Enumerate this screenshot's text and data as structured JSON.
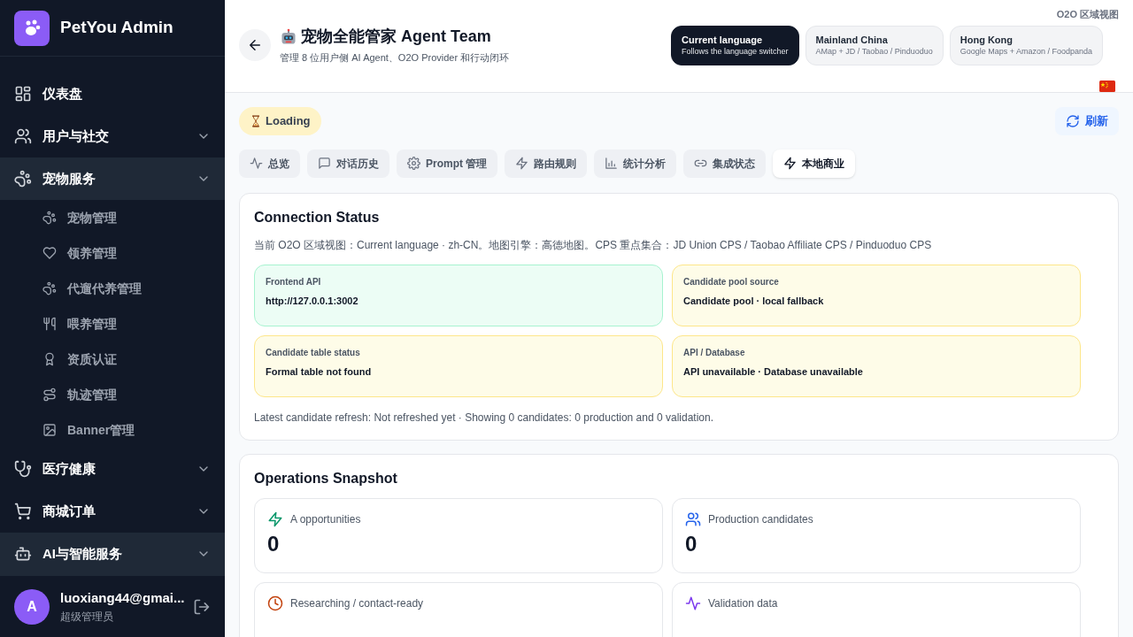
{
  "brand": {
    "name": "PetYou Admin"
  },
  "sidebar": {
    "items": [
      {
        "label": "仪表盘",
        "selected": false,
        "kind": "link"
      },
      {
        "label": "用户与社交",
        "selected": false,
        "kind": "group"
      },
      {
        "label": "宠物服务",
        "selected": true,
        "kind": "group",
        "children": [
          {
            "label": "宠物管理"
          },
          {
            "label": "领养管理"
          },
          {
            "label": "代遛代养管理"
          },
          {
            "label": "喂养管理"
          },
          {
            "label": "资质认证"
          },
          {
            "label": "轨迹管理"
          },
          {
            "label": "Banner管理"
          }
        ]
      },
      {
        "label": "医疗健康",
        "selected": false,
        "kind": "group"
      },
      {
        "label": "商城订单",
        "selected": false,
        "kind": "group"
      },
      {
        "label": "AI与智能服务",
        "selected": true,
        "kind": "group"
      }
    ]
  },
  "user": {
    "avatar": "A",
    "name": "luoxiang44@gmai...",
    "role": "超级管理员"
  },
  "header": {
    "title": "宠物全能管家 Agent Team",
    "subtitle": "管理 8 位用户侧 AI Agent、O2O Provider 和行动闭环",
    "region_label": "O2O 区域视图",
    "regions": [
      {
        "name": "Current language",
        "detail": "Follows the language switcher",
        "selected": true
      },
      {
        "name": "Mainland China",
        "detail": "AMap + JD / Taobao / Pinduoduo",
        "selected": false
      },
      {
        "name": "Hong Kong",
        "detail": "Google Maps + Amazon / Foodpanda",
        "selected": false
      }
    ]
  },
  "status_pill": "Loading",
  "refresh_button": "刷新",
  "tabs": [
    {
      "label": "总览",
      "selected": false
    },
    {
      "label": "对话历史",
      "selected": false
    },
    {
      "label": "Prompt 管理",
      "selected": false
    },
    {
      "label": "路由规则",
      "selected": false
    },
    {
      "label": "统计分析",
      "selected": false
    },
    {
      "label": "集成状态",
      "selected": false
    },
    {
      "label": "本地商业",
      "selected": true
    }
  ],
  "connection": {
    "title": "Connection Status",
    "summary": "当前 O2O 区域视图：Current language · zh-CN。地图引擎：高德地图。CPS 重点集合：JD Union CPS / Taobao Affiliate CPS / Pinduoduo CPS",
    "tiles": [
      {
        "label": "Frontend API",
        "value": "http://127.0.0.1:3002",
        "kind": "ok"
      },
      {
        "label": "Candidate pool source",
        "value": "Candidate pool · local fallback",
        "kind": "warn"
      },
      {
        "label": "Candidate table status",
        "value": "Formal table not found",
        "kind": "warn"
      },
      {
        "label": "API / Database",
        "value": "API unavailable · Database unavailable",
        "kind": "warn"
      }
    ],
    "footnote": "Latest candidate refresh: Not refreshed yet · Showing 0 candidates: 0 production and 0 validation."
  },
  "snapshot": {
    "title": "Operations Snapshot",
    "stats": [
      {
        "label": "A opportunities",
        "value": "0"
      },
      {
        "label": "Production candidates",
        "value": "0"
      },
      {
        "label": "Researching / contact-ready"
      },
      {
        "label": "Validation data"
      }
    ]
  }
}
